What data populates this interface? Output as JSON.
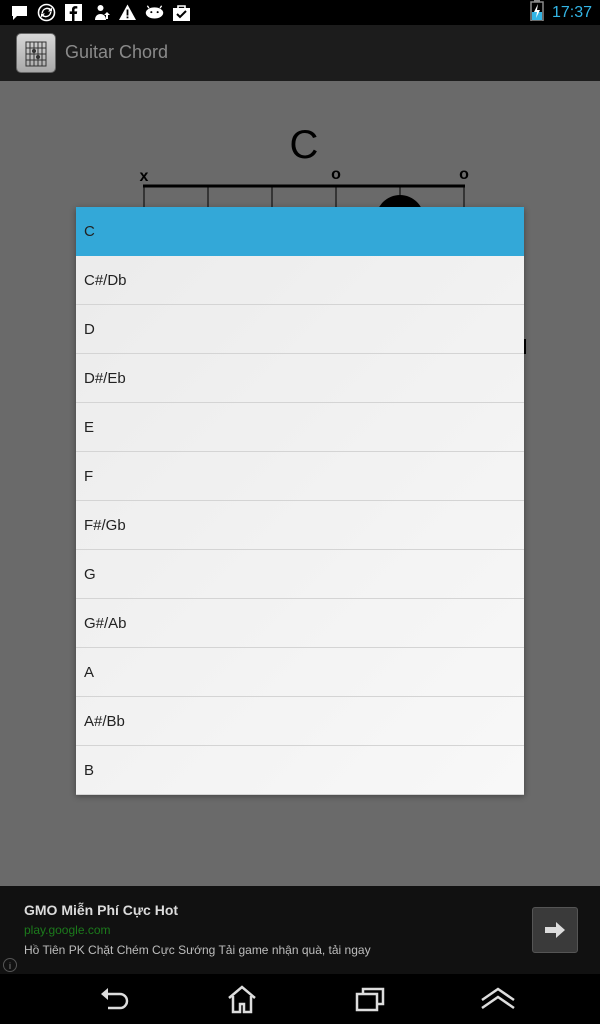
{
  "status_bar": {
    "time": "17:37",
    "icons_left": [
      "chat-icon",
      "sync-icon",
      "facebook-icon",
      "upload-icon",
      "warning-icon",
      "android-icon",
      "checkbag-icon"
    ],
    "icons_right": [
      "battery-charging-icon"
    ]
  },
  "app": {
    "title": "Guitar Chord"
  },
  "chord_view": {
    "chord_name": "C",
    "string_markers": [
      "x",
      "o",
      "o"
    ]
  },
  "dialog": {
    "items": [
      "C",
      "C#/Db",
      "D",
      "D#/Eb",
      "E",
      "F",
      "F#/Gb",
      "G",
      "G#/Ab",
      "A",
      "A#/Bb",
      "B"
    ],
    "selected": "C",
    "selected_color": "#33a8d8"
  },
  "ad": {
    "title": "GMO Miễn Phí Cực Hot",
    "url": "play.google.com",
    "description": "Hồ Tiên PK Chặt Chém Cực Sướng Tải game nhận quà, tải ngay",
    "button_icon": "arrow-right-icon",
    "info_icon": "info-icon"
  },
  "nav": {
    "icons": [
      "back-icon",
      "home-icon",
      "recents-icon",
      "menu-up-icon"
    ]
  },
  "colors": {
    "accent": "#33b5e5",
    "ad_url": "#1c7a1c"
  }
}
